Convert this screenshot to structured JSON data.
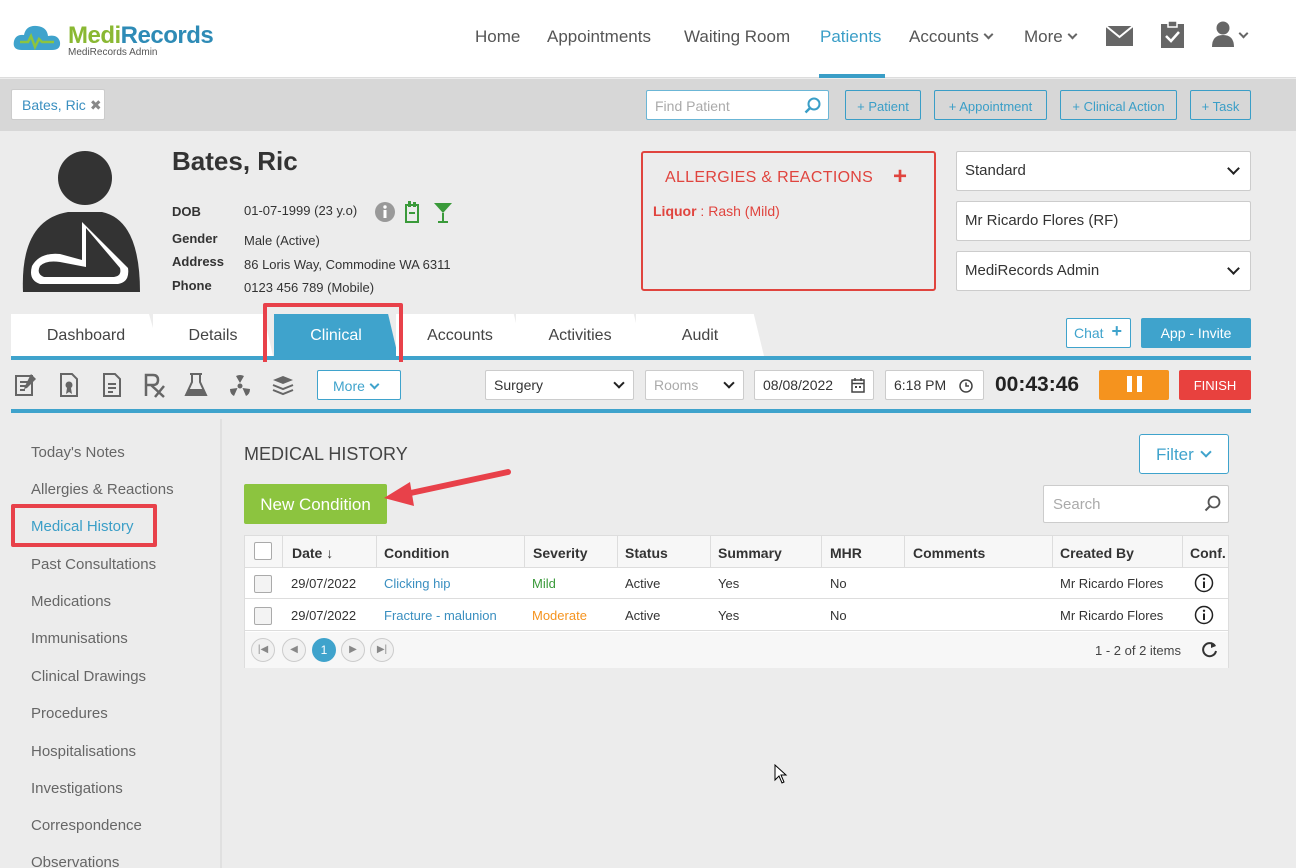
{
  "app": {
    "logo_name": "MediRecords",
    "logo_name_a": "Medi",
    "logo_name_b": "Records",
    "logo_sub": "MediRecords Admin"
  },
  "nav": {
    "home": "Home",
    "appointments": "Appointments",
    "waiting_room": "Waiting Room",
    "patients": "Patients",
    "accounts": "Accounts",
    "more": "More",
    "icons": [
      "mail-icon",
      "clipboard-check-icon",
      "user-icon"
    ]
  },
  "actionbar": {
    "patient_tab": "Bates, Ric",
    "find_patient_placeholder": "Find Patient",
    "add_patient": "+ Patient",
    "add_appointment": "+ Appointment",
    "add_clinical_action": "+ Clinical Action",
    "add_task": "+ Task"
  },
  "patient": {
    "name": "Bates, Ric",
    "dob_label": "DOB",
    "dob": "01-07-1999 (23 y.o)",
    "gender_label": "Gender",
    "gender": "Male (Active)",
    "address_label": "Address",
    "address": "86 Loris Way, Commodine WA 6311",
    "phone_label": "Phone",
    "phone": "0123 456 789 (Mobile)"
  },
  "allergies": {
    "title": "ALLERGIES & REACTIONS",
    "item_substance": "Liquor",
    "item_reaction": " : Rash (Mild)"
  },
  "selectors": {
    "billing": "Standard",
    "practitioner": "Mr Ricardo Flores (RF)",
    "practice": "MediRecords Admin"
  },
  "tabs": {
    "dashboard": "Dashboard",
    "details": "Details",
    "clinical": "Clinical",
    "accounts": "Accounts",
    "activities": "Activities",
    "audit": "Audit",
    "chat": "Chat",
    "app_invite": "App - Invite"
  },
  "toolbar": {
    "more": "More",
    "location": "Surgery",
    "rooms_placeholder": "Rooms",
    "date": "08/08/2022",
    "time": "6:18 PM",
    "timer": "00:43:46",
    "finish": "FINISH"
  },
  "sidebar": {
    "items": [
      "Today's Notes",
      "Allergies & Reactions",
      "Medical History",
      "Past Consultations",
      "Medications",
      "Immunisations",
      "Clinical Drawings",
      "Procedures",
      "Hospitalisations",
      "Investigations",
      "Correspondence",
      "Observations"
    ]
  },
  "medical_history": {
    "title": "MEDICAL HISTORY",
    "filter": "Filter",
    "new_condition": "New Condition",
    "search_placeholder": "Search",
    "columns": [
      "Date",
      "Condition",
      "Severity",
      "Status",
      "Summary",
      "MHR",
      "Comments",
      "Created By",
      "Conf."
    ],
    "sort_indicator": "↓",
    "rows": [
      {
        "date": "29/07/2022",
        "condition": "Clicking hip",
        "severity": "Mild",
        "status": "Active",
        "summary": "Yes",
        "mhr": "No",
        "comments": "",
        "created_by": "Mr Ricardo Flores"
      },
      {
        "date": "29/07/2022",
        "condition": "Fracture - malunion",
        "severity": "Moderate",
        "status": "Active",
        "summary": "Yes",
        "mhr": "No",
        "comments": "",
        "created_by": "Mr Ricardo Flores"
      }
    ],
    "current_page": "1",
    "pager_info": "1 - 2 of 2 items"
  },
  "colors": {
    "accent": "#3fa3cc",
    "danger": "#e8413e",
    "success": "#8cc43f",
    "warning": "#f5931e"
  }
}
